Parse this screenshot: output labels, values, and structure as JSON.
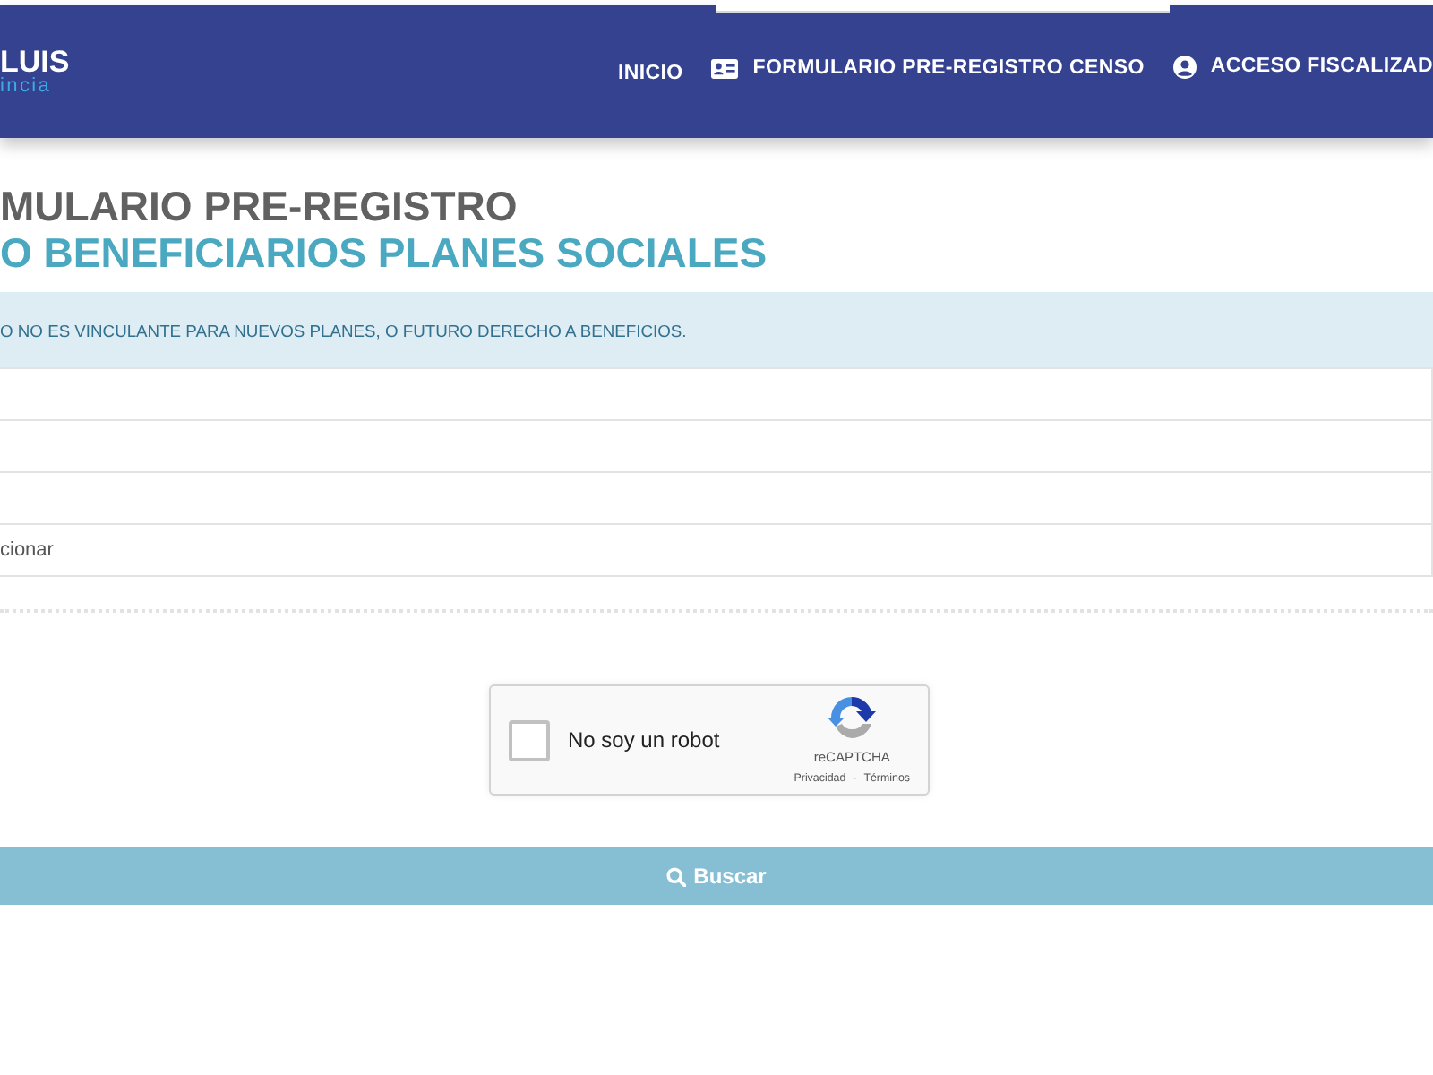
{
  "navbar": {
    "logo": {
      "line_1": "LUIS",
      "line_2": "incia"
    },
    "links": [
      {
        "label": "INICIO",
        "kind": "plain"
      },
      {
        "label": "FORMULARIO PRE-REGISTRO CENSO",
        "kind": "card"
      },
      {
        "label": "ACCESO FISCALIZAD",
        "kind": "account"
      }
    ]
  },
  "title": {
    "line_1": "MULARIO PRE-REGISTRO",
    "line_2": "O BENEFICIARIOS PLANES SOCIALES"
  },
  "notice": "O NO ES VINCULANTE PARA NUEVOS PLANES, O FUTURO DERECHO A BENEFICIOS.",
  "fields": [
    {
      "kind": "input"
    },
    {
      "kind": "input"
    },
    {
      "kind": "input"
    },
    {
      "kind": "select",
      "value": "cionar"
    }
  ],
  "captcha": {
    "label": "No soy un robot",
    "checked": false,
    "brand": "reCAPTCHA",
    "links": [
      "Privacidad",
      "Términos"
    ],
    "separator": "-"
  },
  "button": {
    "label": "Buscar"
  }
}
